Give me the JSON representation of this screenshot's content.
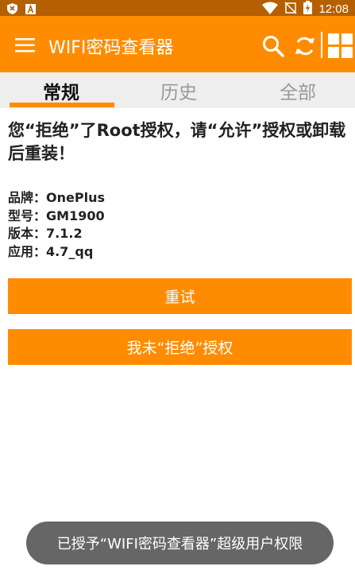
{
  "status_bar": {
    "time": "12:08",
    "icons": [
      "shield-icon",
      "font-a-icon",
      "wifi-icon",
      "no-sim-icon",
      "battery-charging-icon"
    ]
  },
  "app_bar": {
    "title": "WIFI密码查看器",
    "icons": [
      "menu-icon",
      "search-icon",
      "refresh-icon",
      "grid-icon"
    ]
  },
  "tabs": [
    {
      "label": "常规",
      "selected": true
    },
    {
      "label": "历史",
      "selected": false
    },
    {
      "label": "全部",
      "selected": false
    }
  ],
  "message": "您“拒绝”了Root授权，请“允许”授权或卸载后重装！",
  "device_info": [
    {
      "label": "品牌：",
      "value": "OnePlus"
    },
    {
      "label": "型号：",
      "value": "GM1900"
    },
    {
      "label": "版本：",
      "value": "7.1.2"
    },
    {
      "label": "应用：",
      "value": "4.7_qq"
    }
  ],
  "buttons": {
    "retry": "重试",
    "not_refused": "我未“拒绝”授权"
  },
  "toast": "已授予“WIFI密码查看器”超级用户权限",
  "colors": {
    "accent": "#ff8c00",
    "status_bar": "#b45f00",
    "tab_bar": "#eeeeee",
    "toast": "#666666"
  }
}
